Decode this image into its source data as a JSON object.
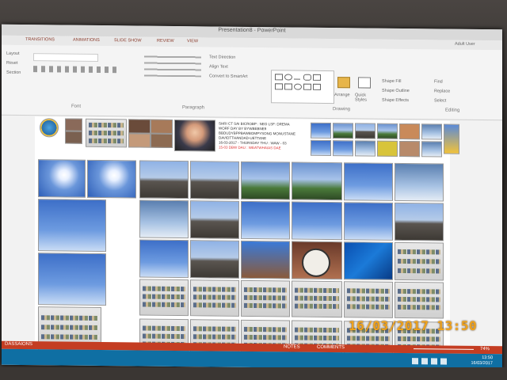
{
  "window": {
    "title": "Presentation8 - PowerPoint",
    "user": "Adult User"
  },
  "ribbon": {
    "tabs": [
      "TRANSITIONS",
      "ANIMATIONS",
      "SLIDE SHOW",
      "REVIEW",
      "VIEW"
    ],
    "layout_label": "Layout",
    "reset_label": "Reset",
    "section_label": "Section",
    "groups": [
      "Font",
      "Paragraph",
      "Drawing",
      "Editing"
    ],
    "text_direction_label": "Text Direction",
    "align_text_label": "Align Text",
    "smartart_label": "Convert to SmartArt",
    "arrange_label": "Arrange",
    "quick_styles_label": "Quick Styles",
    "shape_fill_label": "Shape Fill",
    "shape_outline_label": "Shape Outline",
    "shape_effects_label": "Shape Effects",
    "find_label": "Find",
    "replace_label": "Replace",
    "select_label": "Select"
  },
  "slide": {
    "caption_lines": [
      "SHRI CT SAI BICROBP : NEO LSF: DREMA",
      "WORF DAY BY BYWBEBNE9",
      "BBDUDYBPPBAWBOMPYSONG MONUSTANE",
      "DAVIDTTHANDAD-UETTANE",
      "16-03-2017 - THURSDAY THU : WAW - 03",
      "15-03 DBW DAU : WEATWHAIAS DAE"
    ]
  },
  "statusbar": {
    "left": "DASSAIONS",
    "notes": "NOTES",
    "comments": "COMMENTS",
    "zoom": "74%"
  },
  "taskbar": {
    "time": "13:50",
    "date": "16/03/2017"
  },
  "camera_stamp": "16/03/2017  13:50",
  "colors": {
    "status_bar": "#c43d22",
    "taskbar": "#0f6fa3",
    "stamp": "#f0a21a"
  }
}
